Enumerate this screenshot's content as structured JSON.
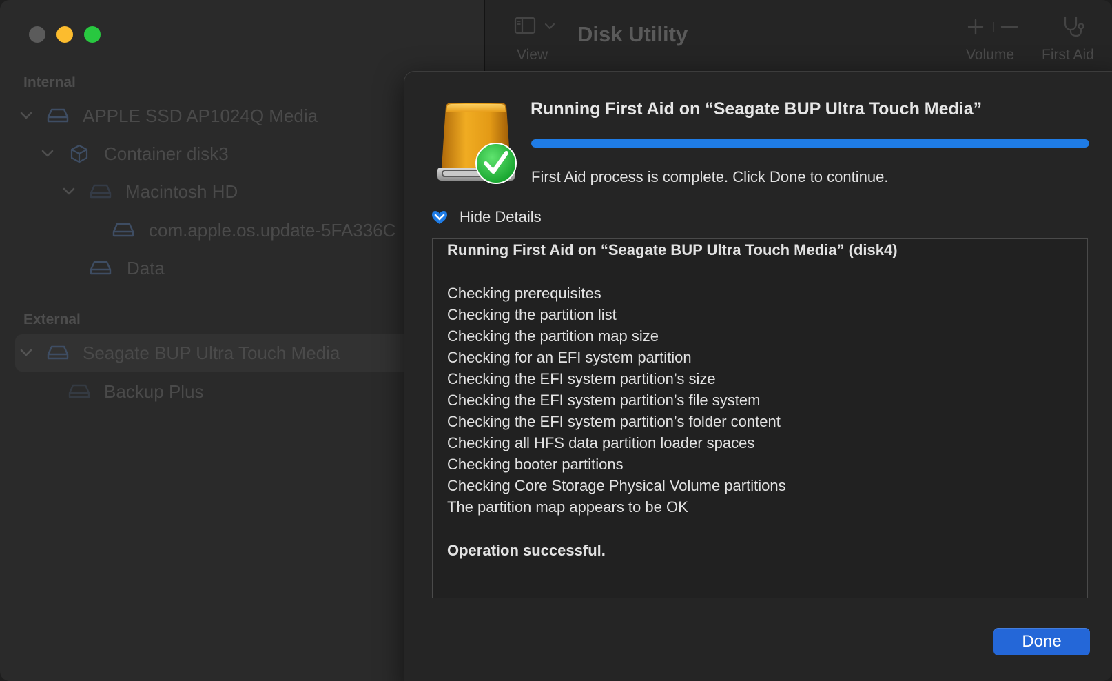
{
  "window": {
    "title": "Disk Utility"
  },
  "toolbar": {
    "view_label": "View",
    "volume_label": "Volume",
    "first_aid_label": "First Aid"
  },
  "sidebar": {
    "internal_label": "Internal",
    "external_label": "External",
    "internal_items": [
      {
        "label": "APPLE SSD AP1024Q Media",
        "icon": "drive-icon"
      },
      {
        "label": "Container disk3",
        "icon": "container-icon"
      },
      {
        "label": "Macintosh HD",
        "icon": "volume-icon"
      },
      {
        "label": "com.apple.os.update-5FA336C",
        "icon": "volume-icon"
      },
      {
        "label": "Data",
        "icon": "volume-icon"
      }
    ],
    "external_items": [
      {
        "label": "Seagate BUP Ultra Touch Media",
        "icon": "drive-icon",
        "selected": true
      },
      {
        "label": "Backup Plus",
        "icon": "volume-icon"
      }
    ]
  },
  "sheet": {
    "title": "Running First Aid on “Seagate BUP Ultra Touch Media”",
    "progress": 1.0,
    "status": "First Aid process is complete. Click Done to continue.",
    "details_toggle": "Hide Details",
    "log": [
      {
        "text": "Running First Aid on “Seagate BUP Ultra Touch Media” (disk4)",
        "bold": true
      },
      {
        "text": "Checking prerequisites",
        "bold": false
      },
      {
        "text": "Checking the partition list",
        "bold": false
      },
      {
        "text": "Checking the partition map size",
        "bold": false
      },
      {
        "text": "Checking for an EFI system partition",
        "bold": false
      },
      {
        "text": "Checking the EFI system partition’s size",
        "bold": false
      },
      {
        "text": "Checking the EFI system partition’s file system",
        "bold": false
      },
      {
        "text": "Checking the EFI system partition’s folder content",
        "bold": false
      },
      {
        "text": "Checking all HFS data partition loader spaces",
        "bold": false
      },
      {
        "text": "Checking booter partitions",
        "bold": false
      },
      {
        "text": "Checking Core Storage Physical Volume partitions",
        "bold": false
      },
      {
        "text": "The partition map appears to be OK",
        "bold": false
      },
      {
        "text": "Operation successful.",
        "bold": true
      }
    ],
    "done_label": "Done"
  },
  "colors": {
    "accent": "#2467d8",
    "progress": "#1f7ce6",
    "drive_gold": "#e8a21c",
    "check_green": "#26b33b"
  }
}
